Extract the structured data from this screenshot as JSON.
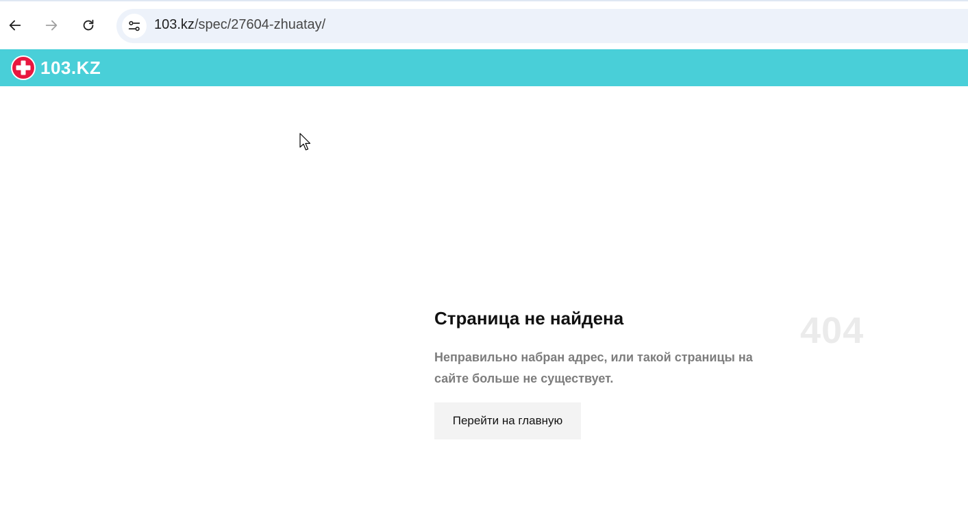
{
  "browser": {
    "url_host": "103.kz",
    "url_path": "/spec/27604-zhuatay/",
    "icons": {
      "back": "arrow-left-icon",
      "forward": "arrow-right-icon",
      "reload": "reload-icon",
      "site_info": "tune-icon"
    }
  },
  "site": {
    "logo_text": "103.KZ",
    "header_color": "#49cfd8",
    "logo_accent_color": "#e8173f"
  },
  "error": {
    "title": "Страница не найдена",
    "code": "404",
    "description": "Неправильно набран адрес, или такой страницы на сайте больше не существует.",
    "button_label": "Перейти на главную"
  }
}
